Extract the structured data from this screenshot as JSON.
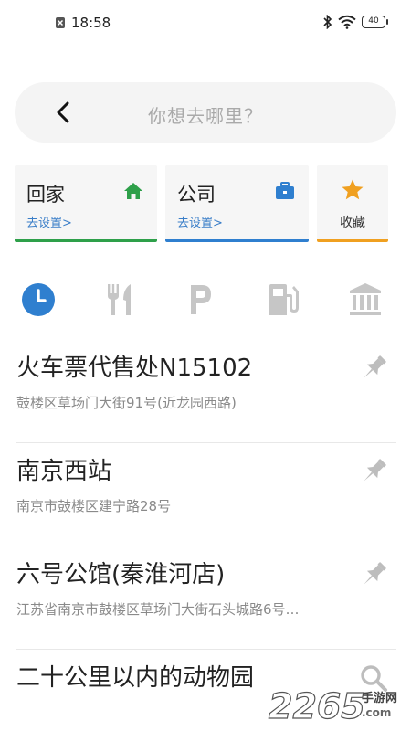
{
  "status": {
    "time": "18:58",
    "battery": "40"
  },
  "search": {
    "placeholder": "你想去哪里？"
  },
  "quick": {
    "home": {
      "title": "回家",
      "sub": "去设置>"
    },
    "company": {
      "title": "公司",
      "sub": "去设置>"
    },
    "favorite": {
      "label": "收藏"
    }
  },
  "categories": [
    "history-icon",
    "food-icon",
    "parking-icon",
    "gas-station-icon",
    "bank-icon"
  ],
  "places": [
    {
      "name": "火车票代售处N15102",
      "address": "鼓楼区草场门大街91号(近龙园西路)"
    },
    {
      "name": "南京西站",
      "address": "南京市鼓楼区建宁路28号"
    },
    {
      "name": "六号公馆(秦淮河店)",
      "address": "江苏省南京市鼓楼区草场门大街石头城路6号…"
    },
    {
      "name": "二十公里以内的动物园"
    }
  ],
  "watermark": {
    "number": "2265",
    "suffix": "手游网",
    "domain": ".com"
  },
  "colors": {
    "home": "#2ea04a",
    "company": "#2f7fcf",
    "favorite": "#f0a020",
    "accent": "#2f7fcf"
  }
}
